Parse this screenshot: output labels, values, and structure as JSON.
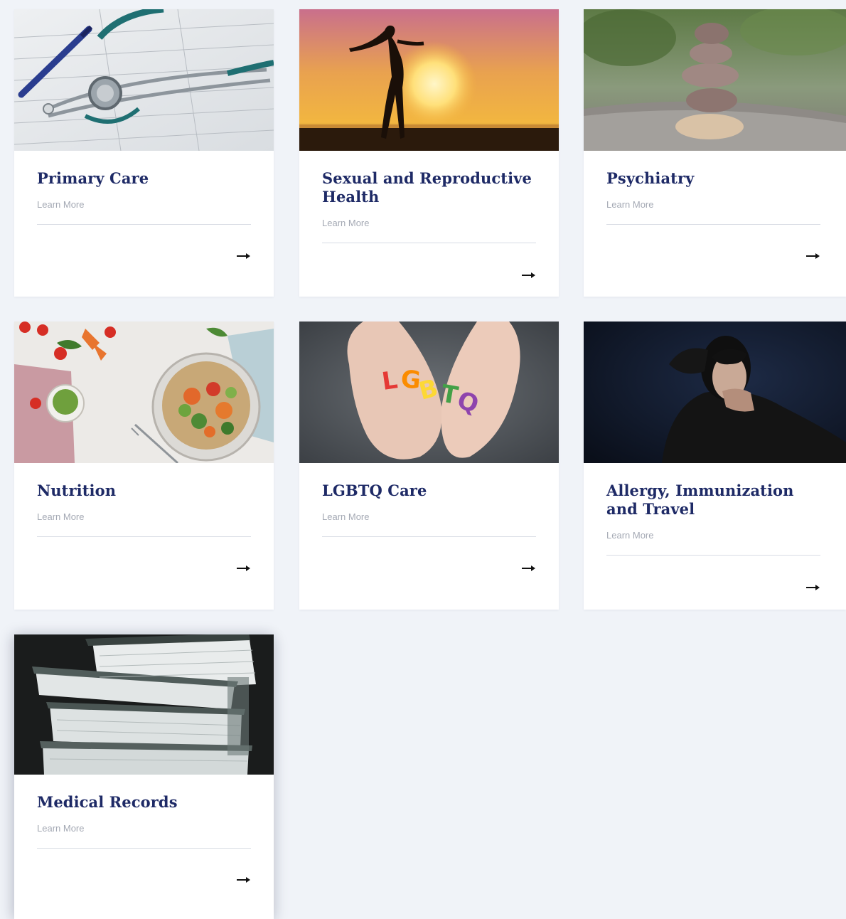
{
  "cards": [
    {
      "title": "Primary Care",
      "link": "Learn More",
      "image": "stethoscope-image"
    },
    {
      "title": "Sexual and Reproductive Health",
      "link": "Learn More",
      "image": "sunset-silhouette-image"
    },
    {
      "title": "Psychiatry",
      "link": "Learn More",
      "image": "stacked-stones-image"
    },
    {
      "title": "Nutrition",
      "link": "Learn More",
      "image": "salad-bowl-image"
    },
    {
      "title": "LGBTQ Care",
      "link": "Learn More",
      "image": "lgbtq-hands-image"
    },
    {
      "title": "Allergy, Immunization and Travel",
      "link": "Learn More",
      "image": "sneezing-woman-image"
    },
    {
      "title": "Medical Records",
      "link": "Learn More",
      "image": "binders-image"
    }
  ],
  "icons": {
    "arrow": "arrow-right-icon"
  },
  "colors": {
    "background": "#f0f3f8",
    "title": "#1e2a66",
    "link": "#a4a9b4",
    "card": "#ffffff"
  }
}
